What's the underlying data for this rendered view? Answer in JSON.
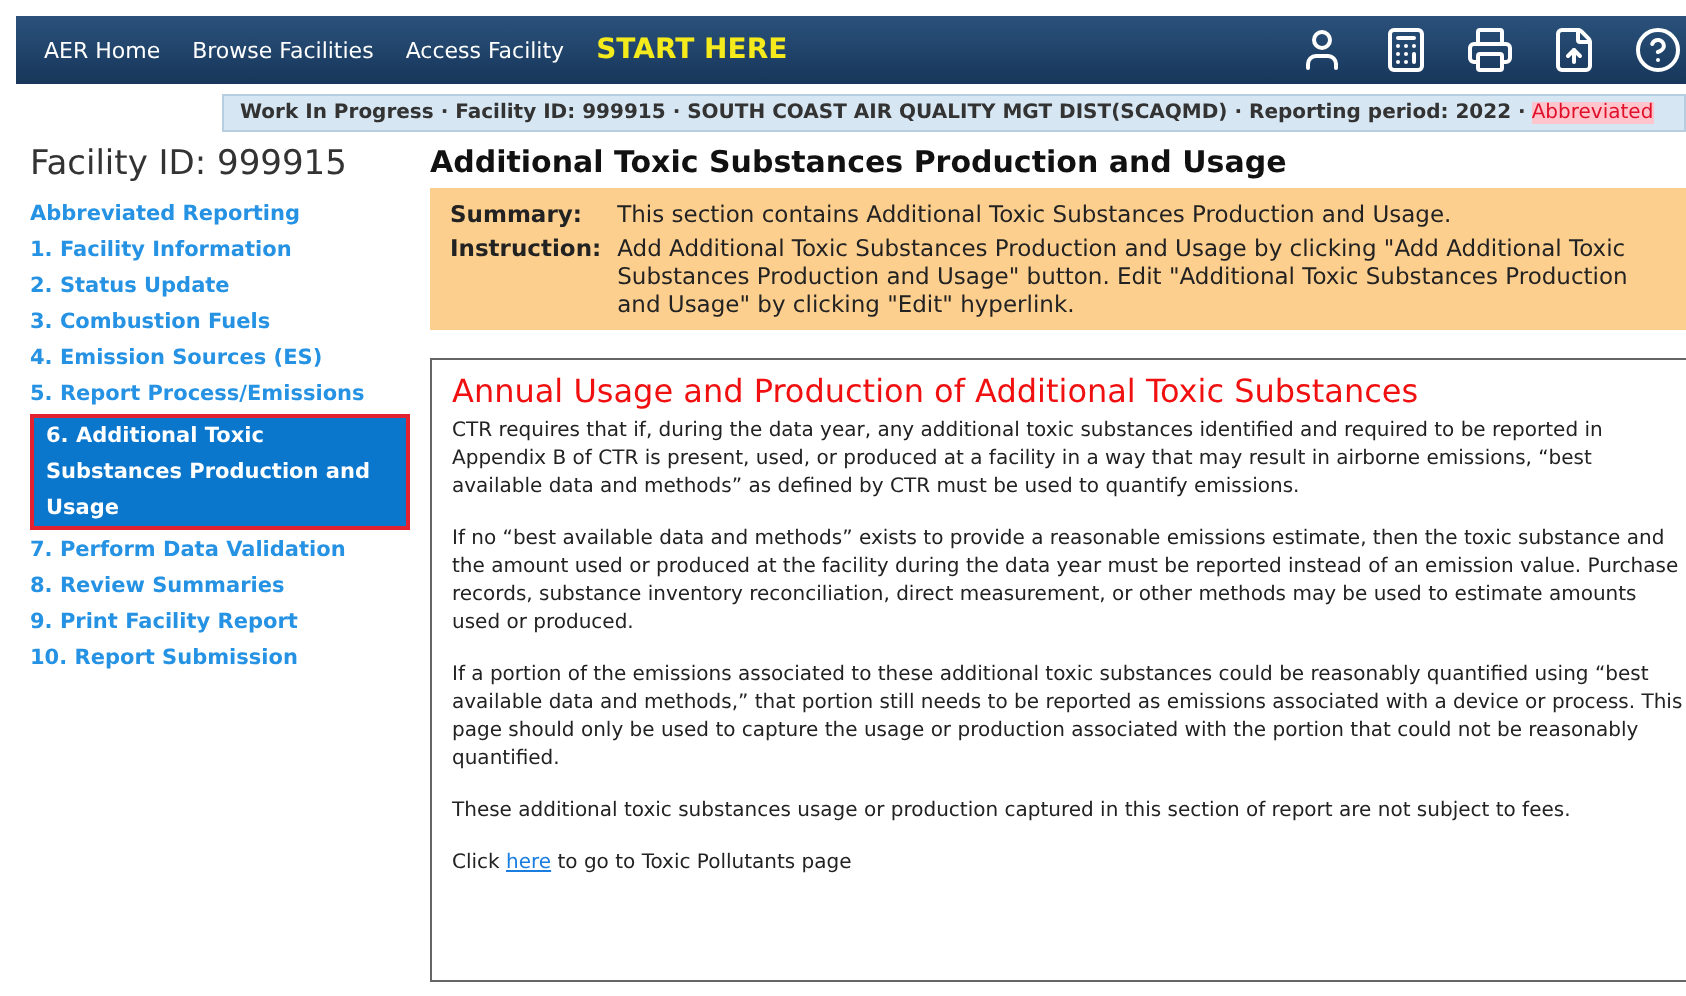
{
  "nav": {
    "links": [
      "AER Home",
      "Browse Facilities",
      "Access Facility"
    ],
    "start": "START HERE"
  },
  "status_bar": {
    "text": "Work In Progress · Facility ID: 999915 · SOUTH COAST AIR QUALITY MGT DIST(SCAQMD) · Reporting period: 2022 ·",
    "flag": "Abbreviated"
  },
  "sidebar": {
    "title": "Facility ID: 999915",
    "items": [
      {
        "label": "Abbreviated Reporting",
        "selected": false
      },
      {
        "label": "1. Facility Information",
        "selected": false
      },
      {
        "label": "2. Status Update",
        "selected": false
      },
      {
        "label": "3. Combustion Fuels",
        "selected": false
      },
      {
        "label": "4. Emission Sources (ES)",
        "selected": false
      },
      {
        "label": "5. Report Process/Emissions",
        "selected": false
      },
      {
        "label": "6. Additional Toxic Substances Production and Usage",
        "selected": true
      },
      {
        "label": "7. Perform Data Validation",
        "selected": false
      },
      {
        "label": "8. Review Summaries",
        "selected": false
      },
      {
        "label": "9. Print Facility Report",
        "selected": false
      },
      {
        "label": "10. Report Submission",
        "selected": false
      }
    ]
  },
  "page_title": "Additional Toxic Substances Production and Usage",
  "info": [
    {
      "label": "Summary:",
      "text": "This section contains Additional Toxic Substances Production and Usage."
    },
    {
      "label": "Instruction:",
      "text": "Add Additional Toxic Substances Production and Usage by clicking \"Add Additional Toxic Substances Production and Usage\" button. Edit \"Additional Toxic Substances Production and Usage\" by clicking \"Edit\" hyperlink."
    }
  ],
  "panel": {
    "heading": "Annual Usage and Production of Additional Toxic Substances",
    "paragraphs": [
      "CTR requires that if, during the data year, any additional toxic substances identified and required to be reported in Appendix B of CTR is present, used, or produced at a facility in a way that may result in airborne emissions, “best available data and methods” as defined by CTR must be used to quantify emissions.",
      "If no “best available data and methods” exists to provide a reasonable emissions estimate, then the toxic substance and the amount used or produced at the facility during the data year must be reported instead of an emission value. Purchase records, substance inventory reconciliation, direct measurement, or other methods may be used to estimate amounts used or produced.",
      "If a portion of the emissions associated to these additional toxic substances could be reasonably quantified using “best available data and methods,” that portion still needs to be reported as emissions associated with a device or process. This page should only be used to capture the usage or production associated with the portion that could not be reasonably quantified.",
      "These additional toxic substances usage or production captured in this section of report are not subject to fees."
    ],
    "link_line": {
      "before": "Click ",
      "link": "here",
      "after": " to go to Toxic Pollutants page"
    }
  }
}
